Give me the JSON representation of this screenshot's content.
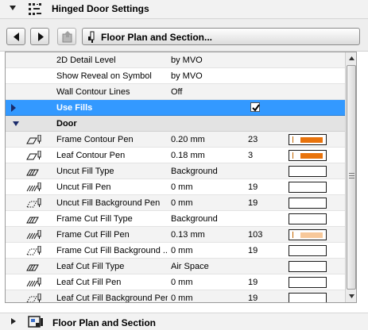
{
  "header": {
    "title": "Hinged Door Settings",
    "icon": "settings-grid-icon"
  },
  "toolbar": {
    "prev_icon": "triangle-left-icon",
    "next_icon": "triangle-right-icon",
    "favorite_icon": "favorite-icon",
    "view_label": "Floor Plan and Section..."
  },
  "list": {
    "rows": [
      {
        "label": "2D Detail Level",
        "value": "by MVO"
      },
      {
        "label": "Show Reveal on Symbol",
        "value": "by MVO"
      },
      {
        "label": "Wall Contour Lines",
        "value": "Off"
      }
    ],
    "use_fills": {
      "label": "Use Fills",
      "checked": true
    },
    "door_section": {
      "label": "Door"
    },
    "door_rows": [
      {
        "label": "Frame Contour Pen",
        "value": "0.20 mm",
        "num": "23",
        "icon": "pen-contour-icon",
        "swatch": "#e8730c"
      },
      {
        "label": "Leaf Contour Pen",
        "value": "0.18 mm",
        "num": "3",
        "icon": "pen-contour-icon",
        "swatch": "#e8730c"
      },
      {
        "label": "Uncut Fill Type",
        "value": "Background",
        "num": "",
        "icon": "fill-type-icon",
        "swatch": ""
      },
      {
        "label": "Uncut Fill Pen",
        "value": "0 mm",
        "num": "19",
        "icon": "fill-pen-icon",
        "swatch": ""
      },
      {
        "label": "Uncut Fill Background Pen",
        "value": "0 mm",
        "num": "19",
        "icon": "fill-bg-pen-icon",
        "swatch": ""
      },
      {
        "label": "Frame Cut Fill Type",
        "value": "Background",
        "num": "",
        "icon": "fill-type-icon",
        "swatch": ""
      },
      {
        "label": "Frame Cut Fill Pen",
        "value": "0.13 mm",
        "num": "103",
        "icon": "fill-pen-icon",
        "swatch": "#f7c89a"
      },
      {
        "label": "Frame Cut Fill Background ...",
        "value": "0 mm",
        "num": "19",
        "icon": "fill-bg-pen-icon",
        "swatch": ""
      },
      {
        "label": "Leaf Cut Fill Type",
        "value": "Air Space",
        "num": "",
        "icon": "fill-type-icon",
        "swatch": ""
      },
      {
        "label": "Leaf Cut Fill Pen",
        "value": "0 mm",
        "num": "19",
        "icon": "fill-pen-icon",
        "swatch": ""
      },
      {
        "label": "Leaf Cut Fill Background Pen",
        "value": "0 mm",
        "num": "19",
        "icon": "fill-bg-pen-icon",
        "swatch": ""
      }
    ]
  },
  "footer": {
    "title": "Floor Plan and Section",
    "icon": "floor-plan-icon"
  },
  "colors": {
    "selection": "#3399ff",
    "accent_orange": "#e8730c",
    "light_orange": "#f7c89a"
  }
}
